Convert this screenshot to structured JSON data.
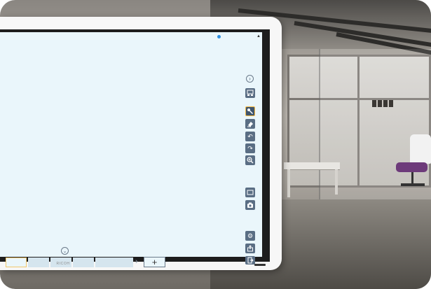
{
  "device": {
    "brand": "RICOH"
  },
  "toolbar": {
    "expand_glyph": "›",
    "tools": [
      {
        "name": "layout-icon"
      },
      {
        "name": "hand-pen-icon"
      },
      {
        "name": "eraser-icon"
      },
      {
        "name": "undo-icon",
        "glyph": "↶"
      },
      {
        "name": "redo-icon",
        "glyph": "↷"
      },
      {
        "name": "zoom-icon"
      },
      {
        "name": "screen-icon"
      },
      {
        "name": "camera-icon"
      },
      {
        "name": "settings-icon",
        "glyph": "⚙"
      },
      {
        "name": "share-icon"
      },
      {
        "name": "exit-icon"
      }
    ]
  },
  "page_bar": {
    "collapse_glyph": "⌄",
    "next_glyph": "›",
    "add_glyph": "+"
  },
  "colors": {
    "canvas": "#eaf6fb",
    "toolbar_button": "#5a6e84",
    "highlight": "#f5b942",
    "indicator": "#2d8fe0"
  }
}
